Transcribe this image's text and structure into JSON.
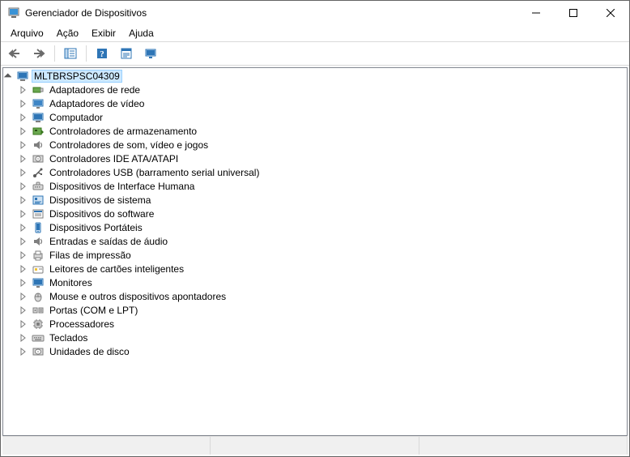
{
  "window": {
    "title": "Gerenciador de Dispositivos"
  },
  "menubar": {
    "items": [
      "Arquivo",
      "Ação",
      "Exibir",
      "Ajuda"
    ]
  },
  "toolbar": {
    "buttons": [
      {
        "name": "back-icon"
      },
      {
        "name": "forward-icon"
      },
      {
        "name": "show-hide-tree-icon"
      },
      {
        "name": "help-icon"
      },
      {
        "name": "properties-icon"
      },
      {
        "name": "scan-hardware-icon"
      }
    ]
  },
  "tree": {
    "root": {
      "label": "MLTBRSPSC04309",
      "icon": "computer-root-icon",
      "expanded": true,
      "selected": true,
      "children": [
        {
          "label": "Adaptadores de rede",
          "icon": "network-adapter-icon"
        },
        {
          "label": "Adaptadores de vídeo",
          "icon": "display-adapter-icon"
        },
        {
          "label": "Computador",
          "icon": "computer-icon"
        },
        {
          "label": "Controladores de armazenamento",
          "icon": "storage-controller-icon"
        },
        {
          "label": "Controladores de som, vídeo e jogos",
          "icon": "sound-controller-icon"
        },
        {
          "label": "Controladores IDE ATA/ATAPI",
          "icon": "ide-controller-icon"
        },
        {
          "label": "Controladores USB (barramento serial universal)",
          "icon": "usb-controller-icon"
        },
        {
          "label": "Dispositivos de Interface Humana",
          "icon": "hid-icon"
        },
        {
          "label": "Dispositivos de sistema",
          "icon": "system-device-icon"
        },
        {
          "label": "Dispositivos do software",
          "icon": "software-device-icon"
        },
        {
          "label": "Dispositivos Portáteis",
          "icon": "portable-device-icon"
        },
        {
          "label": "Entradas e saídas de áudio",
          "icon": "audio-io-icon"
        },
        {
          "label": "Filas de impressão",
          "icon": "print-queue-icon"
        },
        {
          "label": "Leitores de cartões inteligentes",
          "icon": "smartcard-reader-icon"
        },
        {
          "label": "Monitores",
          "icon": "monitor-icon"
        },
        {
          "label": "Mouse e outros dispositivos apontadores",
          "icon": "mouse-icon"
        },
        {
          "label": "Portas (COM e LPT)",
          "icon": "ports-icon"
        },
        {
          "label": "Processadores",
          "icon": "processor-icon"
        },
        {
          "label": "Teclados",
          "icon": "keyboard-icon"
        },
        {
          "label": "Unidades de disco",
          "icon": "disk-drive-icon"
        }
      ]
    }
  }
}
